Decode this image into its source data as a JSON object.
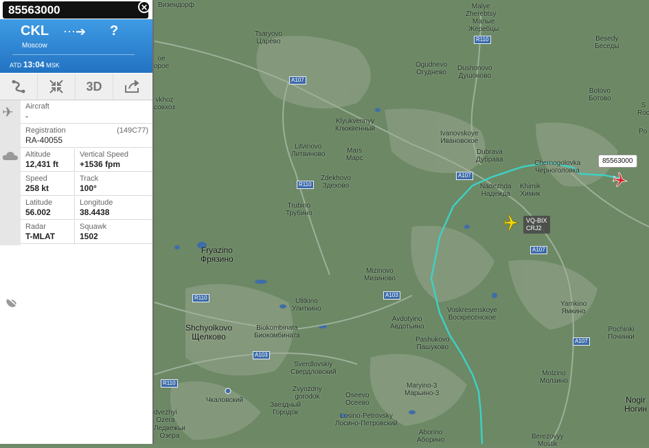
{
  "flight": {
    "callsign": "85563000",
    "origin_code": "CKL",
    "origin_city": "Moscow",
    "dest_code": "?",
    "atd_label": "ATD",
    "atd_time": "13:04",
    "atd_tz": "MSK"
  },
  "toolbar": {
    "route_icon": "route-icon",
    "collapse_icon": "collapse-icon",
    "three_d": "3D",
    "share_icon": "share-icon"
  },
  "details": {
    "aircraft_label": "Aircraft",
    "aircraft_value": "-",
    "registration_label": "Registration",
    "registration_value": "RA-40055",
    "registration_code": "(149C77)",
    "altitude_label": "Altitude",
    "altitude_value": "12,431 ft",
    "vspeed_label": "Vertical Speed",
    "vspeed_value": "+1536 fpm",
    "speed_label": "Speed",
    "speed_value": "258 kt",
    "track_label": "Track",
    "track_value": "100°",
    "lat_label": "Latitude",
    "lat_value": "56.002",
    "lon_label": "Longitude",
    "lon_value": "38.4438",
    "radar_label": "Radar",
    "radar_value": "T-MLAT",
    "squawk_label": "Squawk",
    "squawk_value": "1502"
  },
  "map_tags": {
    "main": "85563000",
    "other_reg": "VQ-BIX",
    "other_type": "CRJ2"
  },
  "towns": [
    {
      "id": "vizendorf",
      "t1": "Визендорф",
      "t2": ""
    },
    {
      "id": "malye",
      "t1": "Malye",
      "t2": "Zherebtsy"
    },
    {
      "id": "malye2",
      "t1": "Малые",
      "t2": "Жеребцы"
    },
    {
      "id": "tsaryovo",
      "t1": "Tsaryovo",
      "t2": "Царёво"
    },
    {
      "id": "besedy",
      "t1": "Besedy",
      "t2": "Беседы"
    },
    {
      "id": "ogudnevo",
      "t1": "Ogudnevo",
      "t2": "Огуднево"
    },
    {
      "id": "dushonovo",
      "t1": "Dushonovo",
      "t2": "Душоново"
    },
    {
      "id": "botovo",
      "t1": "Botovo",
      "t2": "Ботово"
    },
    {
      "id": "klyukvenny",
      "t1": "Klyukvennyy",
      "t2": "Клюквенный"
    },
    {
      "id": "ivanovskoye",
      "t1": "Ivanovskoye",
      "t2": "Ивановское"
    },
    {
      "id": "litvinovo",
      "t1": "Litvinovo",
      "t2": "Литвиново"
    },
    {
      "id": "mars",
      "t1": "Mars",
      "t2": "Марс"
    },
    {
      "id": "dubrava",
      "t1": "Dubrava",
      "t2": "Дубрава"
    },
    {
      "id": "chernogolovka",
      "t1": "Chernogolovka",
      "t2": "Черноголовка"
    },
    {
      "id": "zdekhovo",
      "t1": "Zdekhovo",
      "t2": "Здехово"
    },
    {
      "id": "nadezhda",
      "t1": "Nadezhda",
      "t2": "Надежда"
    },
    {
      "id": "khimik",
      "t1": "Khimik",
      "t2": "Химик"
    },
    {
      "id": "trubino",
      "t1": "Trubino",
      "t2": "Трубино"
    },
    {
      "id": "fryazino",
      "t1": "Fryazino",
      "t2": "Фрязино"
    },
    {
      "id": "mizinovo",
      "t1": "Mizinovo",
      "t2": "Мизиново"
    },
    {
      "id": "ulitkino",
      "t1": "Ulitkino",
      "t2": "Улиткино"
    },
    {
      "id": "voskresenskoye",
      "t1": "Voskresenskoye",
      "t2": "Воскресенское"
    },
    {
      "id": "yamkino",
      "t1": "Yamkino",
      "t2": "Ямкино"
    },
    {
      "id": "avdotyino",
      "t1": "Avdotyino",
      "t2": "Авдотьино"
    },
    {
      "id": "shchyolkovo",
      "t1": "Shchyolkovo",
      "t2": "Щелково"
    },
    {
      "id": "biokombinata",
      "t1": "Biokombinata",
      "t2": "Биокомбината"
    },
    {
      "id": "pashukovo",
      "t1": "Pashukovo",
      "t2": "Пашуково"
    },
    {
      "id": "pochinki",
      "t1": "Pochinki",
      "t2": "Починки"
    },
    {
      "id": "sverdlovskiy",
      "t1": "Sverdlovskiy",
      "t2": "Свердловский"
    },
    {
      "id": "maryino",
      "t1": "Maryino-3",
      "t2": "Марьино-3"
    },
    {
      "id": "molzino",
      "t1": "Molzino",
      "t2": "Молзино"
    },
    {
      "id": "zvyozdny",
      "t1": "Zvyozdny",
      "t2": "gorodok"
    },
    {
      "id": "zvyozdny2",
      "t1": "Звездный",
      "t2": "Городок"
    },
    {
      "id": "oseevo",
      "t1": "Oseevo",
      "t2": "Осеево"
    },
    {
      "id": "chkalovsky",
      "t1": "Чкаловский",
      "t2": ""
    },
    {
      "id": "losino",
      "t1": "Losino-Petrovsky",
      "t2": "Лосино-Петровский"
    },
    {
      "id": "aborino",
      "t1": "Aborino",
      "t2": "Аборино"
    },
    {
      "id": "berezovyy",
      "t1": "Berezovyy",
      "t2": "Mostik"
    },
    {
      "id": "noginsk",
      "t1": "Nogir",
      "t2": "Ногин"
    },
    {
      "id": "dvezhy",
      "t1": "dvezhyi",
      "t2": "Ozera"
    },
    {
      "id": "dvezhy2",
      "t1": "Ледвежьи",
      "t2": "Озера"
    },
    {
      "id": "left1",
      "t1": "ое",
      "t2": "орое"
    },
    {
      "id": "left2",
      "t1": "vkhoz",
      "t2": "совхоз"
    },
    {
      "id": "right_s",
      "t1": "S",
      "t2": "Roc"
    },
    {
      "id": "right_po",
      "t1": "Po",
      "t2": ""
    }
  ],
  "roads": [
    "R110",
    "A107",
    "A107",
    "R110",
    "A107",
    "A107",
    "A103",
    "R110",
    "A107",
    "A103",
    "R110"
  ]
}
